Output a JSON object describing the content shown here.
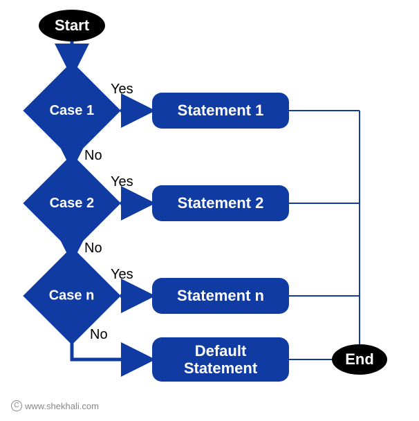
{
  "start": "Start",
  "end": "End",
  "cases": [
    {
      "label": "Case 1",
      "statement": "Statement 1",
      "yes": "Yes",
      "no": "No"
    },
    {
      "label": "Case 2",
      "statement": "Statement 2",
      "yes": "Yes",
      "no": "No"
    },
    {
      "label": "Case n",
      "statement": "Statement n",
      "yes": "Yes",
      "no": "No"
    }
  ],
  "default_statement": "Default\nStatement",
  "credit": "www.shekhali.com",
  "credit_symbol": "C",
  "colors": {
    "primary": "#0f3ba3",
    "oval": "#000000"
  },
  "chart_data": {
    "type": "table",
    "description": "Switch-case flowchart",
    "nodes": [
      {
        "id": "start",
        "type": "terminator",
        "label": "Start"
      },
      {
        "id": "c1",
        "type": "decision",
        "label": "Case 1"
      },
      {
        "id": "s1",
        "type": "process",
        "label": "Statement 1"
      },
      {
        "id": "c2",
        "type": "decision",
        "label": "Case 2"
      },
      {
        "id": "s2",
        "type": "process",
        "label": "Statement 2"
      },
      {
        "id": "cn",
        "type": "decision",
        "label": "Case n"
      },
      {
        "id": "sn",
        "type": "process",
        "label": "Statement n"
      },
      {
        "id": "def",
        "type": "process",
        "label": "Default Statement"
      },
      {
        "id": "end",
        "type": "terminator",
        "label": "End"
      }
    ],
    "edges": [
      {
        "from": "start",
        "to": "c1"
      },
      {
        "from": "c1",
        "to": "s1",
        "label": "Yes"
      },
      {
        "from": "c1",
        "to": "c2",
        "label": "No"
      },
      {
        "from": "c2",
        "to": "s2",
        "label": "Yes"
      },
      {
        "from": "c2",
        "to": "cn",
        "label": "No"
      },
      {
        "from": "cn",
        "to": "sn",
        "label": "Yes"
      },
      {
        "from": "cn",
        "to": "def",
        "label": "No"
      },
      {
        "from": "s1",
        "to": "end"
      },
      {
        "from": "s2",
        "to": "end"
      },
      {
        "from": "sn",
        "to": "end"
      },
      {
        "from": "def",
        "to": "end"
      }
    ]
  }
}
